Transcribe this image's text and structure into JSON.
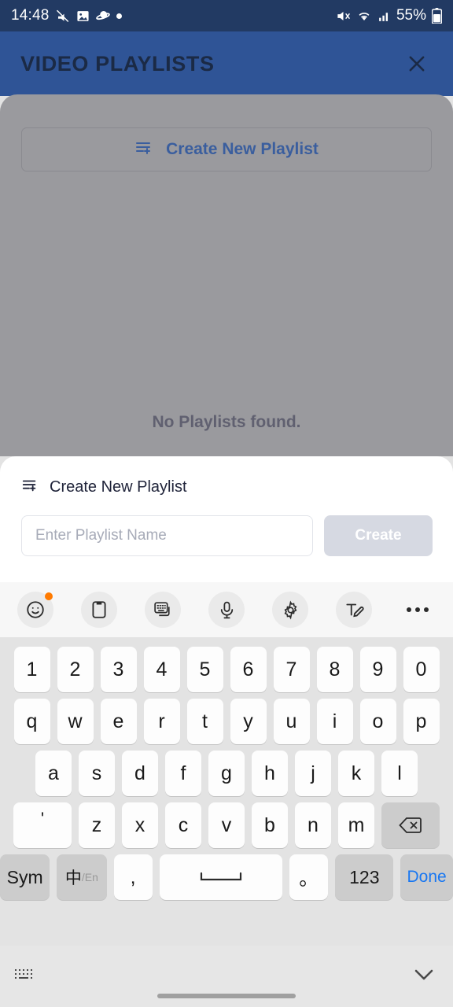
{
  "status_bar": {
    "time": "14:48",
    "left_icons": [
      "no-sound-alert-icon",
      "image-icon",
      "saturn-icon",
      "dot-icon"
    ],
    "right_icons": [
      "mute-icon",
      "wifi-icon",
      "signal-icon"
    ],
    "battery_percent": "55%"
  },
  "header": {
    "title": "VIDEO PLAYLISTS",
    "close_icon": "close-icon",
    "background_color": "#2F5496"
  },
  "content": {
    "create_button": {
      "label": "Create New Playlist",
      "icon": "playlist-add-icon",
      "color": "#3A5E9E"
    },
    "empty_state": "No Playlists found."
  },
  "sheet": {
    "title": "Create New Playlist",
    "icon": "playlist-add-icon",
    "input": {
      "placeholder": "Enter Playlist Name",
      "value": ""
    },
    "create_label": "Create",
    "create_enabled": false
  },
  "keyboard": {
    "toolbar": [
      {
        "name": "emoji-icon",
        "badge": true
      },
      {
        "name": "clipboard-icon",
        "badge": false
      },
      {
        "name": "keyboard-switch-icon",
        "badge": false
      },
      {
        "name": "microphone-icon",
        "badge": false
      },
      {
        "name": "gear-icon",
        "badge": false
      },
      {
        "name": "handwriting-icon",
        "badge": false
      },
      {
        "name": "more-icon",
        "badge": false
      }
    ],
    "rows": {
      "numbers": [
        "1",
        "2",
        "3",
        "4",
        "5",
        "6",
        "7",
        "8",
        "9",
        "0"
      ],
      "top": [
        "q",
        "w",
        "e",
        "r",
        "t",
        "y",
        "u",
        "i",
        "o",
        "p"
      ],
      "home": [
        "a",
        "s",
        "d",
        "f",
        "g",
        "h",
        "j",
        "k",
        "l"
      ],
      "bottom": [
        "z",
        "x",
        "c",
        "v",
        "b",
        "n",
        "m"
      ],
      "apostrophe": "'",
      "backspace_icon": "backspace-icon"
    },
    "function_row": {
      "sym": "Sym",
      "lang_primary": "中",
      "lang_separator": "/",
      "lang_secondary": "En",
      "comma": ",",
      "space_icon": "space-bar-icon",
      "period": "。",
      "numeric": "123",
      "done": "Done",
      "done_color": "#1877F2"
    }
  },
  "nav_bar": {
    "keyboard_layout_icon": "keyboard-layout-icon",
    "hide_keyboard_icon": "chevron-down-icon",
    "home_indicator": "home-indicator"
  }
}
